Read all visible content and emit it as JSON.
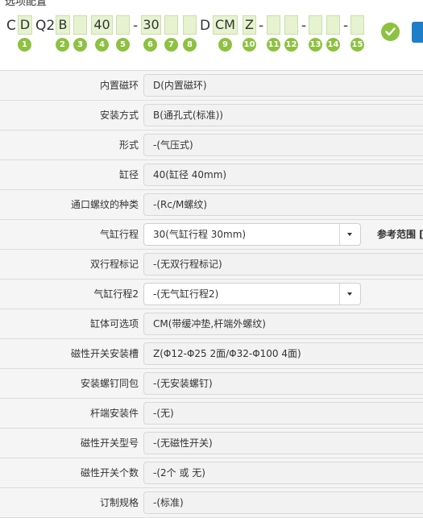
{
  "header": {
    "title": "选项配置"
  },
  "code": {
    "prefix_c": "C",
    "seg_d": "D",
    "series": "Q2",
    "seg_mount": "B",
    "seg_form": "",
    "seg_bore": "40",
    "seg_thread": "",
    "dash1": "-",
    "seg_stroke": "30",
    "seg_dual": "",
    "seg_stroke2": "",
    "prefix_d": "D",
    "seg_option": "CM",
    "seg_slot": "Z",
    "dash2": "-",
    "seg_screw": "",
    "seg_rodend": "",
    "dash3": "-",
    "seg_switch": "",
    "seg_count": "",
    "dash4": "-",
    "seg_custom": "",
    "numbers": [
      "1",
      "2",
      "3",
      "4",
      "5",
      "6",
      "7",
      "8",
      "9",
      "10",
      "11",
      "12",
      "13",
      "14",
      "15"
    ]
  },
  "rows": [
    {
      "label": "内置磁环",
      "value": "D(内置磁环)"
    },
    {
      "label": "安装方式",
      "value": "B(通孔式(标准))"
    },
    {
      "label": "形式",
      "value": "-(气压式)"
    },
    {
      "label": "缸径",
      "value": "40(缸径 40mm)"
    },
    {
      "label": "通口螺纹的种类",
      "value": "-(Rc/M螺纹)"
    },
    {
      "label": "气缸行程",
      "value": "30(气缸行程 30mm)",
      "ref": "参考范围 ["
    },
    {
      "label": "双行程标记",
      "value": "-(无双行程标记)"
    },
    {
      "label": "气缸行程2",
      "value": "-(无气缸行程2)"
    },
    {
      "label": "缸体可选项",
      "value": "CM(带缓冲垫,杆端外螺纹)"
    },
    {
      "label": "磁性开关安装槽",
      "value": "Z(Φ12-Φ25 2面/Φ32-Φ100 4面)"
    },
    {
      "label": "安装螺钉同包",
      "value": "-(无安装螺钉)"
    },
    {
      "label": "杆端安装件",
      "value": "-(无)"
    },
    {
      "label": "磁性开关型号",
      "value": "-(无磁性开关)"
    },
    {
      "label": "磁性开关个数",
      "value": "-(2个 或 无)"
    },
    {
      "label": "订制规格",
      "value": "-(标准)"
    }
  ],
  "colors": {
    "accent_green": "#8dc140",
    "code_box_bg": "#e6f2d0",
    "button_blue": "#1e7ec8"
  },
  "icons": {
    "confirm": "check-circle-icon",
    "dropdown": "caret-down-icon"
  }
}
